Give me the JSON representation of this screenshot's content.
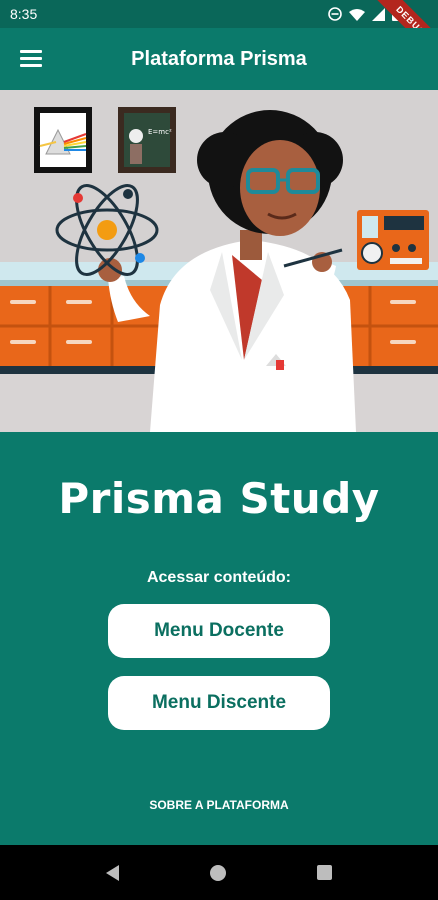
{
  "status_bar": {
    "time": "8:35",
    "icons": [
      "do-not-disturb-icon",
      "wifi-icon",
      "signal-icon",
      "battery-icon"
    ],
    "debug_banner": "DEBUG"
  },
  "app_bar": {
    "title": "Plataforma Prisma",
    "menu_icon": "hamburger-menu-icon"
  },
  "hero": {
    "illustration": "scientist-woman-lab-illustration"
  },
  "main": {
    "app_name": "Prisma Study",
    "access_label": "Acessar conteúdo:",
    "buttons": [
      "Menu Docente",
      "Menu Discente"
    ],
    "about_link": "SOBRE A PLATAFORMA"
  },
  "colors": {
    "primary": "#0b7a6b",
    "status_bar": "#0a6759",
    "button_bg": "#ffffff",
    "button_text": "#0b6f60"
  },
  "nav_bar": {
    "icons": [
      "back-icon",
      "home-icon",
      "recents-icon"
    ]
  }
}
